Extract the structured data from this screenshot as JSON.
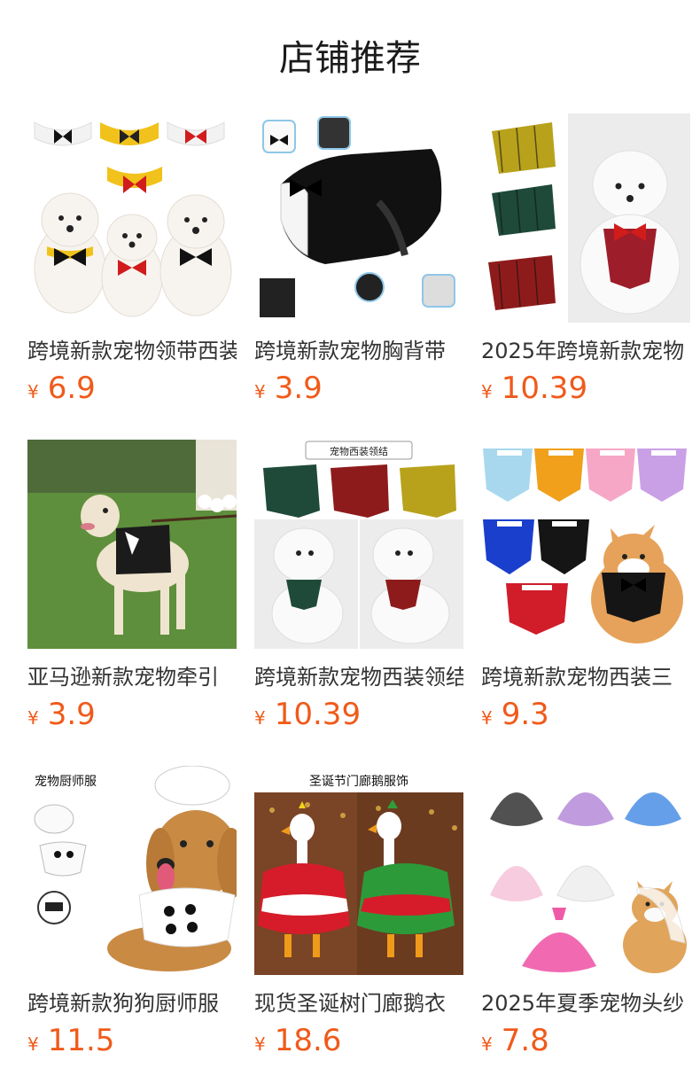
{
  "header": {
    "title": "店铺推荐"
  },
  "colors": {
    "accent": "#f05a1a",
    "text": "#333333"
  },
  "currency": "¥",
  "products": [
    {
      "title": "跨境新款宠物领带西装",
      "price": "6.9",
      "image": "three-white-dogs-bow-ties",
      "image_text": ""
    },
    {
      "title": "跨境新款宠物胸背带",
      "price": "3.9",
      "image": "tuxedo-harness-diagram",
      "image_text": ""
    },
    {
      "title": "2025年跨境新款宠物",
      "price": "10.39",
      "image": "plaid-bandana-poodle",
      "image_text": ""
    },
    {
      "title": "亚马逊新款宠物牵引",
      "price": "3.9",
      "image": "dog-tuxedo-on-lawn",
      "image_text": ""
    },
    {
      "title": "跨境新款宠物西装领结",
      "price": "10.39",
      "image": "plush-poodles-plaid-collars",
      "image_text": "宠物西装领结"
    },
    {
      "title": "跨境新款宠物西装三",
      "price": "9.3",
      "image": "color-bandanas-corgi",
      "image_text": ""
    },
    {
      "title": "跨境新款狗狗厨师服",
      "price": "11.5",
      "image": "dog-chef-costume",
      "image_text": "宠物厨师服"
    },
    {
      "title": "现货圣诞树门廊鹅衣",
      "price": "18.6",
      "image": "christmas-goose-costumes",
      "image_text": "圣诞节门廊鹅服饰"
    },
    {
      "title": "2025年夏季宠物头纱",
      "price": "7.8",
      "image": "veils-shiba",
      "image_text": ""
    }
  ]
}
